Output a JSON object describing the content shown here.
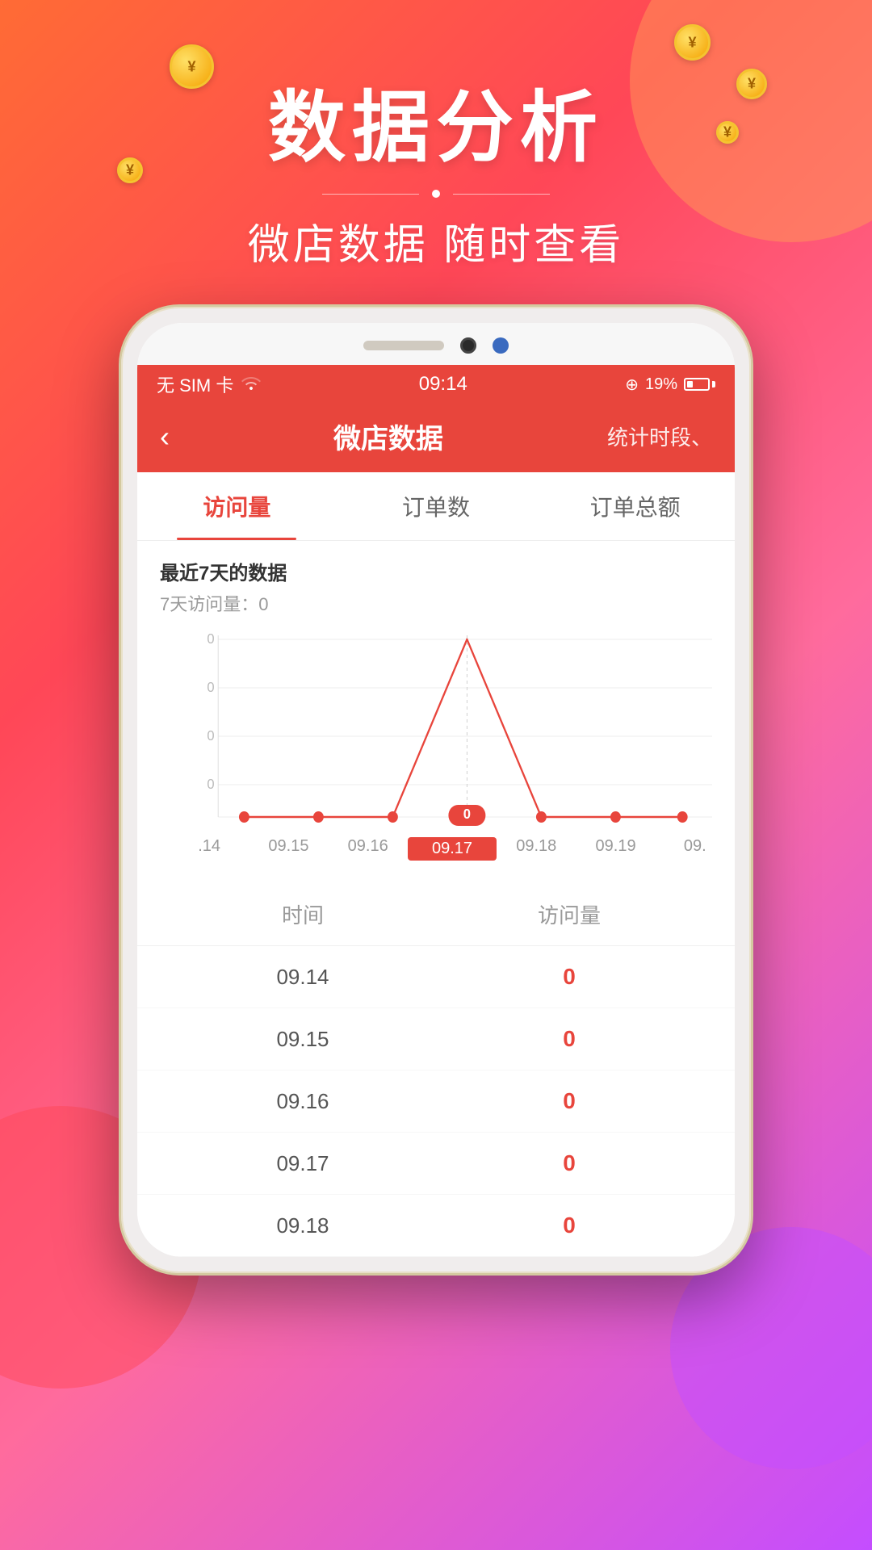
{
  "background": {
    "gradient_start": "#ff6b35",
    "gradient_end": "#c44dff"
  },
  "hero": {
    "title": "数据分析",
    "subtitle": "微店数据  随时查看"
  },
  "status_bar": {
    "carrier": "无 SIM 卡",
    "wifi": "wifi",
    "time": "09:14",
    "location": "⊕",
    "battery_percent": "19%"
  },
  "app_header": {
    "back_icon": "‹",
    "title": "微店数据",
    "action": "统计时段、"
  },
  "tabs": [
    {
      "label": "访问量",
      "active": true
    },
    {
      "label": "订单数",
      "active": false
    },
    {
      "label": "订单总额",
      "active": false
    }
  ],
  "chart": {
    "period_label": "最近7天的数据",
    "total_label": "7天访问量：0",
    "y_axis_labels": [
      "0",
      "0",
      "0",
      "0"
    ],
    "highlighted_date": "09.17",
    "highlighted_value": "0",
    "dates": [
      ".14",
      "09.15",
      "09.16",
      "09.17",
      "09.18",
      "09.19",
      "09."
    ],
    "data_points": [
      0,
      0,
      0,
      0,
      0,
      0,
      0
    ]
  },
  "table": {
    "col_time": "时间",
    "col_value": "访问量",
    "rows": [
      {
        "date": "09.14",
        "value": "0"
      },
      {
        "date": "09.15",
        "value": "0"
      },
      {
        "date": "09.16",
        "value": "0"
      },
      {
        "date": "09.17",
        "value": "0"
      },
      {
        "date": "09.18",
        "value": "0"
      }
    ]
  }
}
